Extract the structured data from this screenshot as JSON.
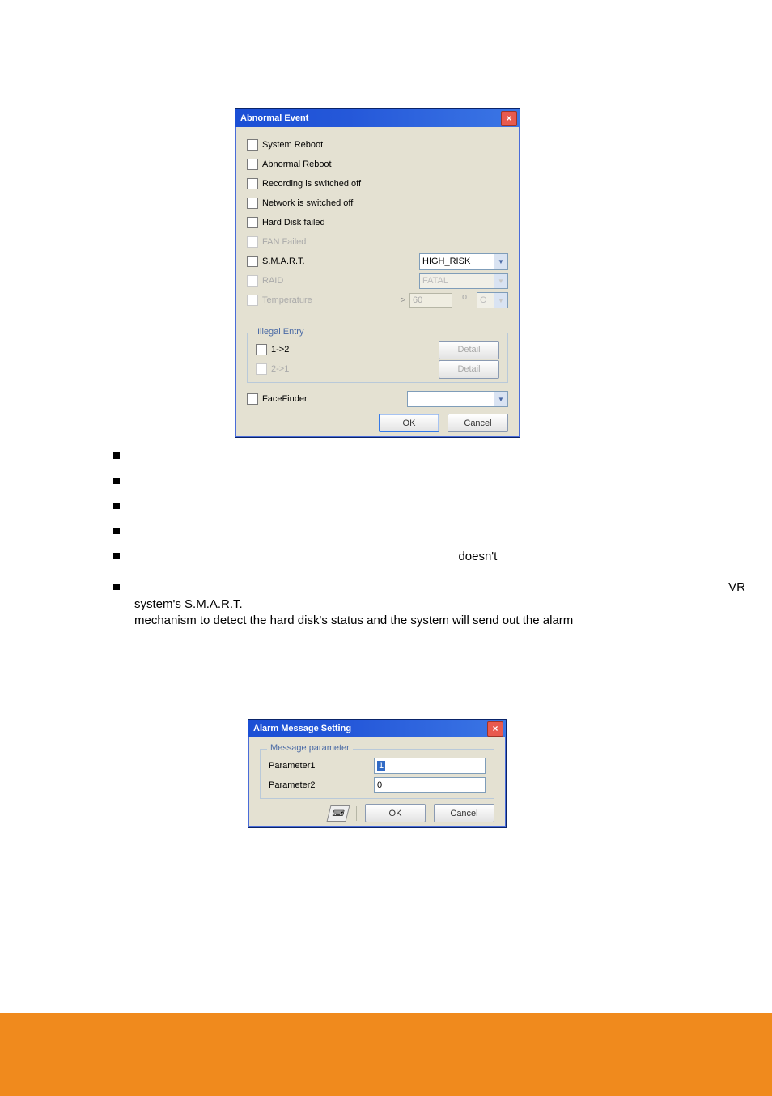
{
  "win1": {
    "title": "Abnormal Event",
    "items": [
      {
        "label": "System Reboot",
        "disabled": false
      },
      {
        "label": "Abnormal Reboot",
        "disabled": false
      },
      {
        "label": "Recording is switched off",
        "disabled": false
      },
      {
        "label": "Network is switched off",
        "disabled": false
      },
      {
        "label": "Hard Disk failed",
        "disabled": false
      },
      {
        "label": "FAN Failed",
        "disabled": true
      }
    ],
    "smart_label": "S.M.A.R.T.",
    "smart_sel": "HIGH_RISK",
    "raid_label": "RAID",
    "raid_sel": "FATAL",
    "temp_label": "Temperature",
    "temp_val": "60",
    "temp_deg": "o",
    "temp_unit": "C",
    "gt": ">",
    "group_label": "Illegal Entry",
    "ent1": "1->2",
    "ent2": "2->1",
    "detail": "Detail",
    "face_label": "FaceFinder",
    "ok": "OK",
    "cancel": "Cancel"
  },
  "bullets": {
    "b1": "",
    "b2": "",
    "b3": "",
    "b4": "",
    "b5": "doesn't",
    "b6a": "VR system's S.M.A.R.T.",
    "b6b": "mechanism to detect the hard disk's status and the system will send out the alarm"
  },
  "win2": {
    "title": "Alarm Message Setting",
    "group_label": "Message parameter",
    "p1_label": "Parameter1",
    "p1_val": "1",
    "p2_label": "Parameter2",
    "p2_val": "0",
    "ok": "OK",
    "cancel": "Cancel"
  }
}
